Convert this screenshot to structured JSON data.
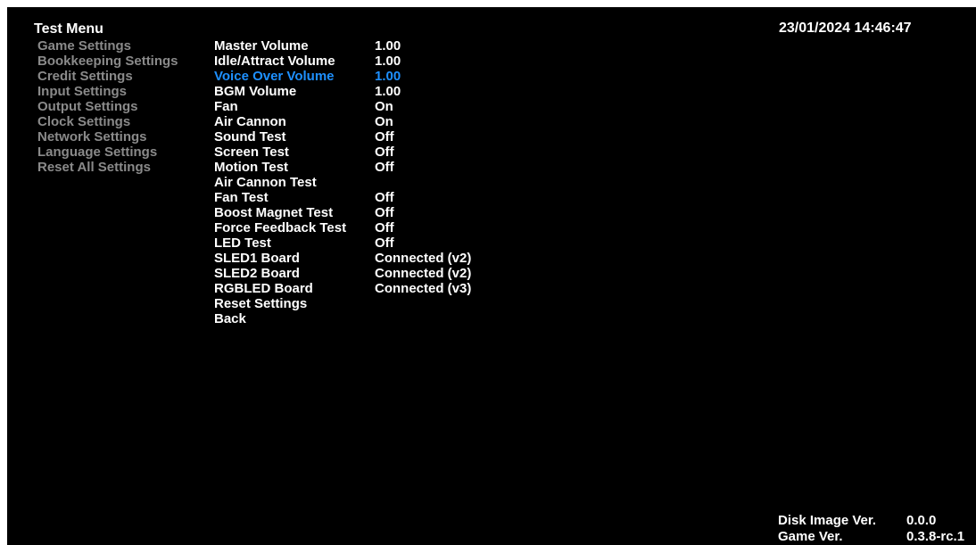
{
  "header": {
    "title": "Test Menu",
    "datetime": "23/01/2024 14:46:47"
  },
  "colors": {
    "background": "#000000",
    "text": "#ffffff",
    "inactive_menu": "#8a8a8a",
    "selected": "#1e90ff"
  },
  "left_menu": {
    "items": [
      {
        "label": "Game Settings"
      },
      {
        "label": "Bookkeeping Settings"
      },
      {
        "label": "Credit Settings"
      },
      {
        "label": "Input Settings"
      },
      {
        "label": "Output Settings"
      },
      {
        "label": "Clock Settings"
      },
      {
        "label": "Network Settings"
      },
      {
        "label": "Language Settings"
      },
      {
        "label": "Reset All Settings"
      }
    ]
  },
  "settings": {
    "selected_index": 2,
    "rows": [
      {
        "label": "Master Volume",
        "value": "1.00"
      },
      {
        "label": "Idle/Attract Volume",
        "value": "1.00"
      },
      {
        "label": "Voice Over Volume",
        "value": "1.00"
      },
      {
        "label": "BGM Volume",
        "value": "1.00"
      },
      {
        "label": "Fan",
        "value": "On"
      },
      {
        "label": "Air Cannon",
        "value": "On"
      },
      {
        "label": "Sound Test",
        "value": "Off"
      },
      {
        "label": "Screen Test",
        "value": "Off"
      },
      {
        "label": "Motion Test",
        "value": "Off"
      },
      {
        "label": "Air Cannon Test",
        "value": ""
      },
      {
        "label": "Fan Test",
        "value": "Off"
      },
      {
        "label": "Boost Magnet Test",
        "value": "Off"
      },
      {
        "label": "Force Feedback Test",
        "value": "Off"
      },
      {
        "label": "LED Test",
        "value": "Off"
      },
      {
        "label": "SLED1 Board",
        "value": "Connected (v2)"
      },
      {
        "label": "SLED2 Board",
        "value": "Connected (v2)"
      },
      {
        "label": "RGBLED Board",
        "value": "Connected (v3)"
      },
      {
        "label": "Reset Settings",
        "value": ""
      },
      {
        "label": "Back",
        "value": ""
      }
    ]
  },
  "footer": {
    "disk_image_label": "Disk Image Ver.",
    "disk_image_value": "0.0.0",
    "game_label": "Game Ver.",
    "game_value": "0.3.8-rc.1"
  }
}
